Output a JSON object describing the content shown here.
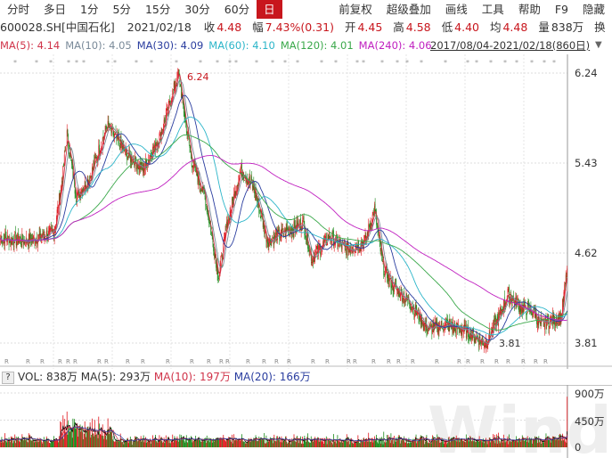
{
  "toolbar": {
    "items": [
      "分时",
      "多日",
      "1分",
      "5分",
      "15分",
      "30分",
      "60分",
      "日"
    ],
    "active": "日",
    "right": [
      "前复权",
      "超级叠加",
      "画线",
      "工具",
      "帮助",
      "F9",
      "隐藏"
    ]
  },
  "info": {
    "code": "600028.SH[中国石化]",
    "date": "2021/02/18",
    "close_label": "收",
    "close": "4.48",
    "chg_label": "幅",
    "chg": "7.43%(0.31)",
    "open_label": "开",
    "open": "4.45",
    "high_label": "高",
    "high": "4.58",
    "low_label": "低",
    "low": "4.40",
    "avg_label": "均",
    "avg": "4.48",
    "vol_label": "量",
    "vol": "838万",
    "turn_label": "换"
  },
  "ma": [
    {
      "label": "MA(5): 4.14",
      "color": "#d0344a"
    },
    {
      "label": "MA(10): 4.05",
      "color": "#7a8a99"
    },
    {
      "label": "MA(30): 4.09",
      "color": "#2a3d9f"
    },
    {
      "label": "MA(60): 4.10",
      "color": "#2bb5c9"
    },
    {
      "label": "MA(120): 4.01",
      "color": "#3aa84a"
    },
    {
      "label": "MA(240): 4.06",
      "color": "#c020c0"
    }
  ],
  "range": "2017/08/04-2021/02/18(860日)",
  "volume": {
    "vol": "VOL: 838万",
    "ma5": "MA(5): 293万",
    "ma10": "MA(10): 197万",
    "ma20": "MA(20): 166万",
    "help": "?",
    "ticks": [
      "900万",
      "450万",
      "0"
    ]
  },
  "colors": {
    "up": "#e0151b",
    "down": "#1a8a1a"
  },
  "watermark": "Wind",
  "chart_data": {
    "type": "candlestick",
    "title": "600028.SH 日线",
    "y_ticks": [
      6.24,
      5.43,
      4.62,
      3.81
    ],
    "max_label": "6.24",
    "min_label": "3.81",
    "days": 860,
    "close_keypoints": [
      [
        0,
        4.75
      ],
      [
        40,
        4.73
      ],
      [
        81,
        4.8
      ],
      [
        94,
        5.29
      ],
      [
        101,
        5.69
      ],
      [
        115,
        5.13
      ],
      [
        135,
        5.29
      ],
      [
        162,
        5.77
      ],
      [
        189,
        5.53
      ],
      [
        216,
        5.37
      ],
      [
        243,
        5.69
      ],
      [
        270,
        6.24
      ],
      [
        277,
        5.94
      ],
      [
        290,
        5.45
      ],
      [
        310,
        5.13
      ],
      [
        331,
        4.41
      ],
      [
        344,
        4.89
      ],
      [
        364,
        5.37
      ],
      [
        384,
        5.21
      ],
      [
        405,
        4.73
      ],
      [
        432,
        4.81
      ],
      [
        459,
        4.89
      ],
      [
        472,
        4.57
      ],
      [
        499,
        4.77
      ],
      [
        526,
        4.65
      ],
      [
        553,
        4.73
      ],
      [
        567,
        5.01
      ],
      [
        580,
        4.49
      ],
      [
        594,
        4.33
      ],
      [
        621,
        4.17
      ],
      [
        648,
        3.93
      ],
      [
        675,
        3.97
      ],
      [
        702,
        3.93
      ],
      [
        735,
        3.81
      ],
      [
        756,
        4.05
      ],
      [
        769,
        4.25
      ],
      [
        789,
        4.13
      ],
      [
        810,
        4.09
      ],
      [
        817,
        3.97
      ],
      [
        850,
        4.05
      ],
      [
        859,
        4.48
      ]
    ],
    "volume_axis": [
      0,
      450,
      900
    ],
    "volume_unit": "万",
    "last_volume": 838
  }
}
